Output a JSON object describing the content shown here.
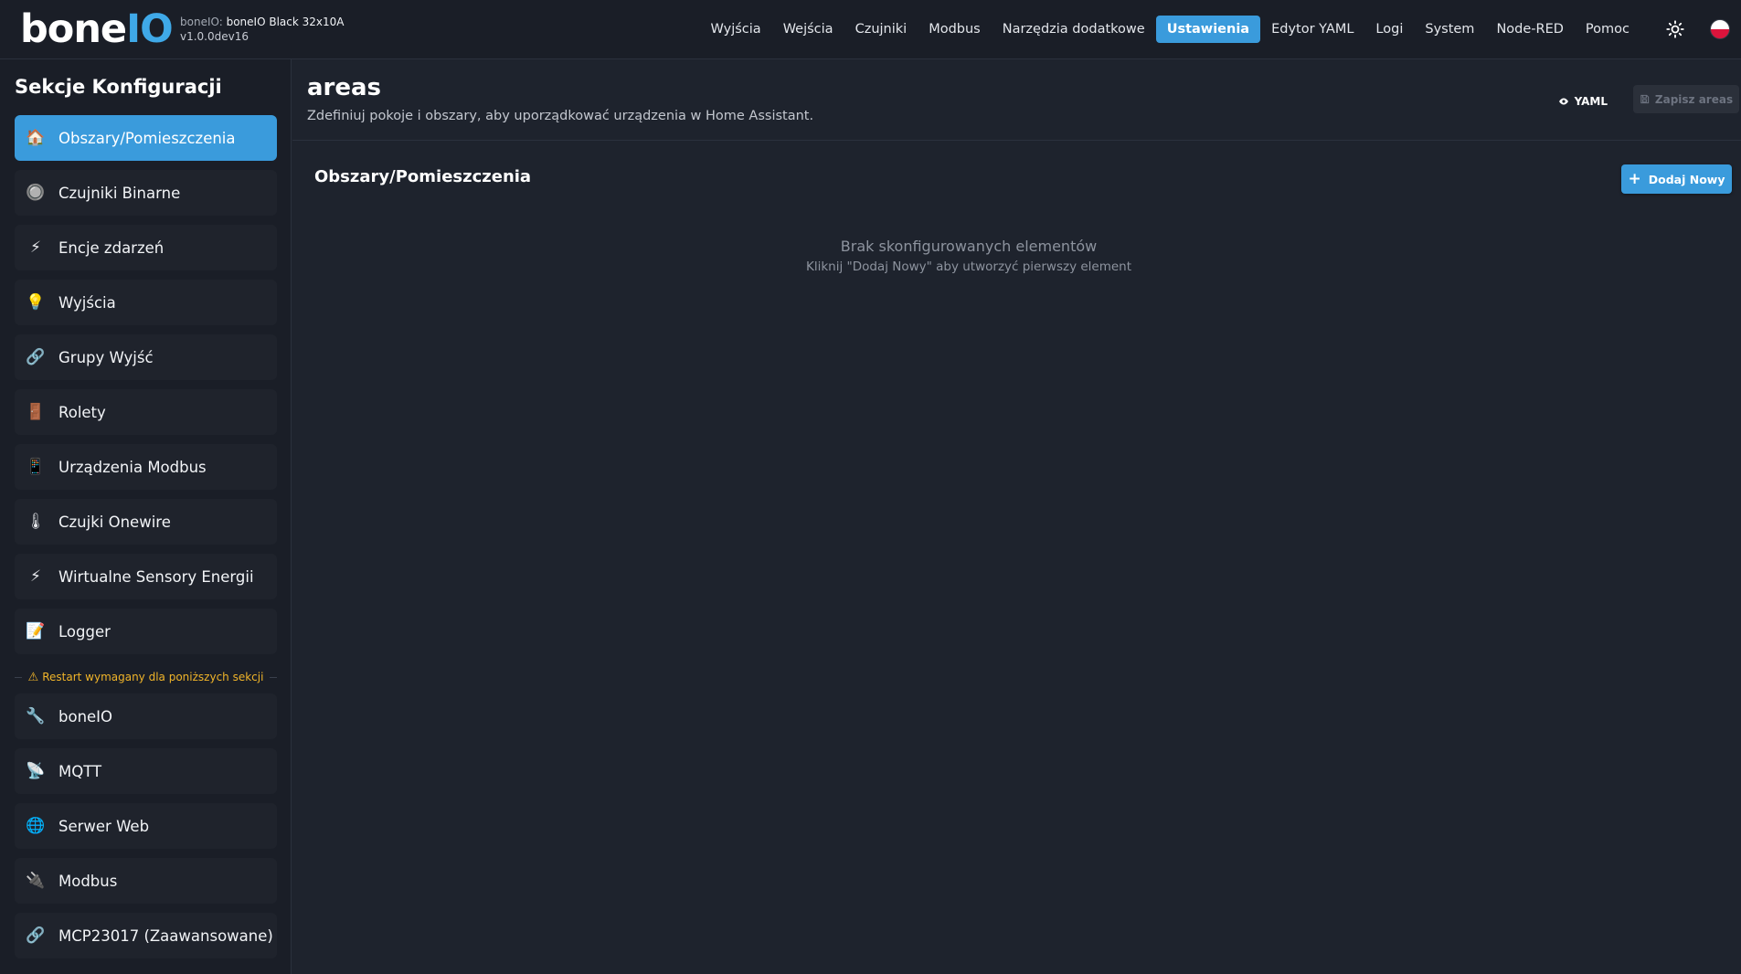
{
  "header": {
    "logo_main": "bone",
    "logo_accent": "IO",
    "device_label": "boneIO:",
    "device_name": "boneIO Black 32x10A",
    "version": "v1.0.0dev16",
    "nav": [
      {
        "label": "Wyjścia",
        "active": false
      },
      {
        "label": "Wejścia",
        "active": false
      },
      {
        "label": "Czujniki",
        "active": false
      },
      {
        "label": "Modbus",
        "active": false
      },
      {
        "label": "Narzędzia dodatkowe",
        "active": false
      },
      {
        "label": "Ustawienia",
        "active": true
      },
      {
        "label": "Edytor YAML",
        "active": false
      },
      {
        "label": "Logi",
        "active": false
      },
      {
        "label": "System",
        "active": false
      },
      {
        "label": "Node-RED",
        "active": false
      },
      {
        "label": "Pomoc",
        "active": false
      }
    ],
    "theme_icon": "sun-icon",
    "language_icon": "polish-flag-icon"
  },
  "sidebar": {
    "title": "Sekcje Konfiguracji",
    "items": [
      {
        "icon": "🏠",
        "label": "Obszary/Pomieszczenia",
        "active": true
      },
      {
        "icon": "🔘",
        "label": "Czujniki Binarne"
      },
      {
        "icon": "⚡",
        "label": "Encje zdarzeń"
      },
      {
        "icon": "💡",
        "label": "Wyjścia"
      },
      {
        "icon": "🔗",
        "label": "Grupy Wyjść"
      },
      {
        "icon": "🚪",
        "label": "Rolety"
      },
      {
        "icon": "📱",
        "label": "Urządzenia Modbus"
      },
      {
        "icon": "🌡",
        "label": "Czujki Onewire"
      },
      {
        "icon": "⚡",
        "label": "Wirtualne Sensory Energii"
      },
      {
        "icon": "📝",
        "label": "Logger"
      }
    ],
    "restart_warning": "Restart wymagany dla poniższych sekcji",
    "restart_items": [
      {
        "icon": "🔧",
        "label": "boneIO"
      },
      {
        "icon": "📡",
        "label": "MQTT"
      },
      {
        "icon": "🌐",
        "label": "Serwer Web"
      },
      {
        "icon": "🔌",
        "label": "Modbus"
      },
      {
        "icon": "🔗",
        "label": "MCP23017 (Zaawansowane)"
      }
    ]
  },
  "main": {
    "title": "areas",
    "description": "Zdefiniuj pokoje i obszary, aby uporządkować urządzenia w Home Assistant.",
    "yaml_button": "YAML",
    "save_button": "Zapisz areas",
    "section_title": "Obszary/Pomieszczenia",
    "add_button": "Dodaj Nowy",
    "empty_title": "Brak skonfigurowanych elementów",
    "empty_hint": "Kliknij \"Dodaj Nowy\" aby utworzyć pierwszy element"
  },
  "colors": {
    "accent": "#3a9bdc",
    "background": "#1e232d",
    "panel": "#1a1e27",
    "warning": "#f0b429"
  }
}
